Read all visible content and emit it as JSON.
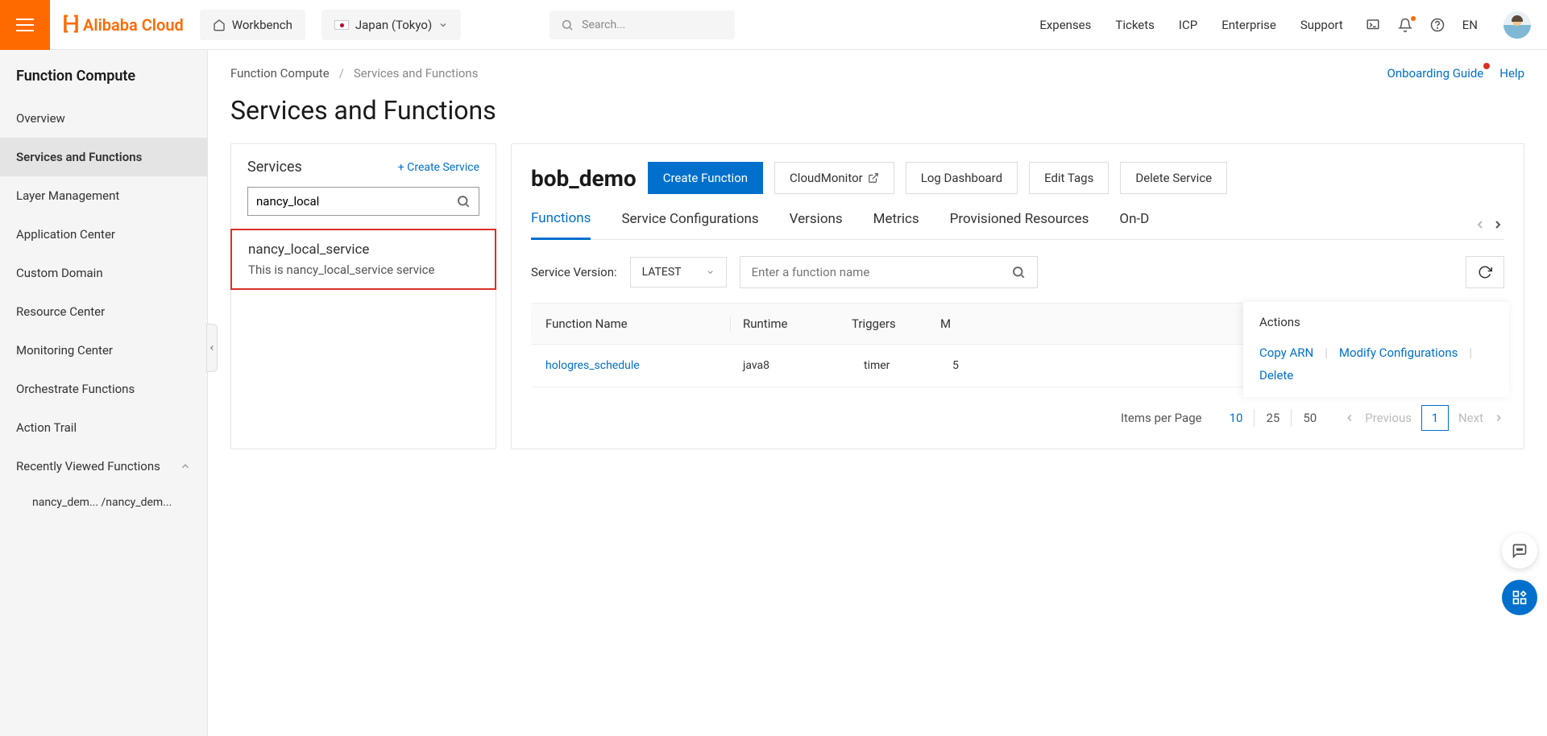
{
  "topbar": {
    "logo_text": "Alibaba Cloud",
    "workbench": "Workbench",
    "region": "Japan (Tokyo)",
    "search_placeholder": "Search...",
    "nav": {
      "expenses": "Expenses",
      "tickets": "Tickets",
      "icp": "ICP",
      "enterprise": "Enterprise",
      "support": "Support"
    },
    "lang": "EN"
  },
  "sidebar": {
    "title": "Function Compute",
    "items": {
      "overview": "Overview",
      "services": "Services and Functions",
      "layer": "Layer Management",
      "appcenter": "Application Center",
      "domain": "Custom Domain",
      "resource": "Resource Center",
      "monitoring": "Monitoring Center",
      "orchestrate": "Orchestrate Functions",
      "actiontrail": "Action Trail",
      "recent": "Recently Viewed Functions"
    },
    "recent_item": "nancy_dem... /nancy_dem..."
  },
  "breadcrumb": {
    "root": "Function Compute",
    "current": "Services and Functions",
    "onboarding": "Onboarding Guide",
    "help": "Help"
  },
  "page_title": "Services and Functions",
  "services_panel": {
    "heading": "Services",
    "create": "+ Create Service",
    "search_value": "nancy_local",
    "item": {
      "name": "nancy_local_service",
      "desc": "This is nancy_local_service service"
    }
  },
  "main_panel": {
    "service_name": "bob_demo",
    "buttons": {
      "create": "Create Function",
      "cloudmonitor": "CloudMonitor",
      "logdash": "Log Dashboard",
      "edittags": "Edit Tags",
      "delete": "Delete Service"
    },
    "tabs": {
      "functions": "Functions",
      "svc_conf": "Service Configurations",
      "versions": "Versions",
      "metrics": "Metrics",
      "provisioned": "Provisioned Resources",
      "ondemand": "On-D"
    },
    "version_label": "Service Version:",
    "version_value": "LATEST",
    "fn_search_placeholder": "Enter a function name",
    "columns": {
      "fn": "Function Name",
      "rt": "Runtime",
      "tr": "Triggers",
      "mem": "M"
    },
    "row": {
      "fn": "hologres_schedule",
      "rt": "java8",
      "tr": "timer",
      "mem": "5"
    },
    "actions": {
      "heading": "Actions",
      "copy": "Copy ARN",
      "modify": "Modify Configurations",
      "delete": "Delete"
    },
    "pager": {
      "ipp": "Items per Page",
      "s10": "10",
      "s25": "25",
      "s50": "50",
      "prev": "Previous",
      "page": "1",
      "next": "Next"
    }
  }
}
